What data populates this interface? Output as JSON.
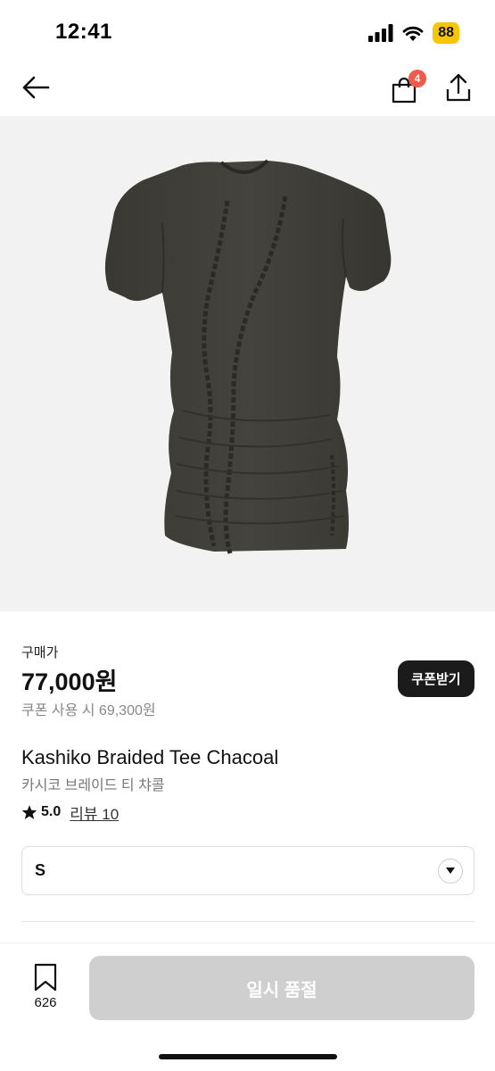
{
  "status_bar": {
    "time": "12:41",
    "battery": "88"
  },
  "header": {
    "cart_count": "4"
  },
  "product": {
    "price_label": "구매가",
    "price": "77,000원",
    "coupon_price": "쿠폰 사용 시 69,300원",
    "coupon_button": "쿠폰받기",
    "name": "Kashiko Braided Tee Chacoal",
    "name_ko": "카시코 브레이드 티 챠콜",
    "rating": "5.0",
    "review_link": "리뷰 10",
    "size_selected": "S"
  },
  "bottom_bar": {
    "bookmark_count": "626",
    "soldout_label": "일시 품절"
  },
  "icons": {
    "back": "back-arrow-icon",
    "cart": "shopping-bag-icon",
    "share": "share-icon",
    "star": "star-icon",
    "chevron": "chevron-down-icon",
    "bookmark": "bookmark-icon"
  },
  "colors": {
    "badge_red": "#ef5a4a",
    "battery_yellow": "#f7c600",
    "coupon_button_bg": "#1b1b1b",
    "soldout_bg": "#cfcfcf",
    "image_bg": "#f2f2f2"
  }
}
